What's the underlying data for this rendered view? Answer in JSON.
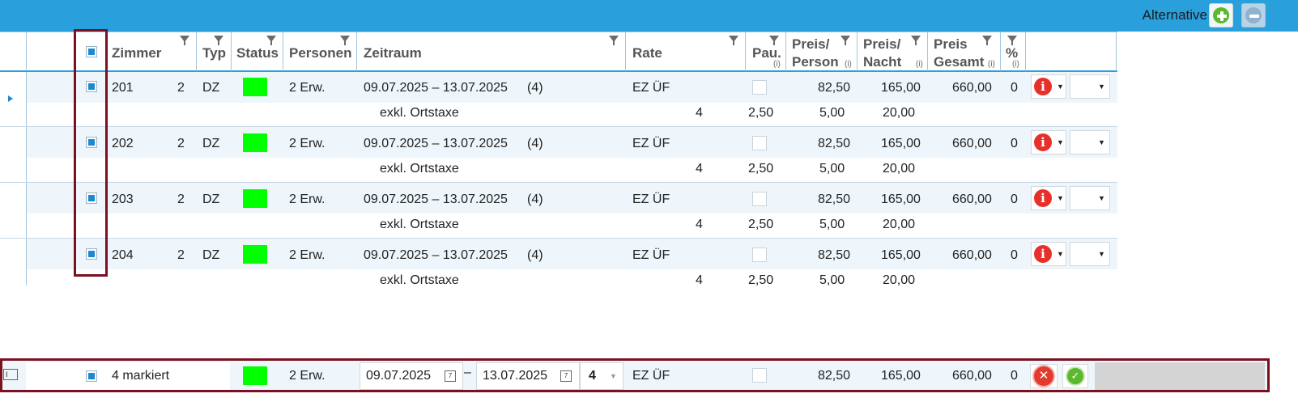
{
  "toolbar": {
    "alternative_label": "Alternative",
    "add_icon": "plus-circle-icon",
    "remove_icon": "minus-circle-icon",
    "accent_color": "#29a0dc"
  },
  "columns": {
    "zimmer": "Zimmer",
    "typ": "Typ",
    "status": "Status",
    "personen": "Personen",
    "zeitraum": "Zeitraum",
    "rate": "Rate",
    "pau": "Pau.",
    "preis_person_1": "Preis/",
    "preis_person_2": "Person",
    "preis_nacht_1": "Preis/",
    "preis_nacht_2": "Nacht",
    "preis_gesamt_1": "Preis",
    "preis_gesamt_2": "Gesamt",
    "prozent": "%",
    "info": "(i)"
  },
  "rows": [
    {
      "zimmer": "201",
      "beds": "2",
      "typ": "DZ",
      "personen": "2 Erw.",
      "zeitraum": "09.07.2025 – 13.07.2025",
      "nights": "(4)",
      "rate": "EZ ÜF",
      "preis_person": "82,50",
      "preis_nacht": "165,00",
      "preis_gesamt": "660,00",
      "prozent": "0",
      "sub_label": "exkl. Ortstaxe",
      "sub_qty": "4",
      "sub_pau": "2,50",
      "sub_person": "5,00",
      "sub_nacht": "20,00",
      "status_color": "#00ff00"
    },
    {
      "zimmer": "202",
      "beds": "2",
      "typ": "DZ",
      "personen": "2 Erw.",
      "zeitraum": "09.07.2025 – 13.07.2025",
      "nights": "(4)",
      "rate": "EZ ÜF",
      "preis_person": "82,50",
      "preis_nacht": "165,00",
      "preis_gesamt": "660,00",
      "prozent": "0",
      "sub_label": "exkl. Ortstaxe",
      "sub_qty": "4",
      "sub_pau": "2,50",
      "sub_person": "5,00",
      "sub_nacht": "20,00",
      "status_color": "#00ff00"
    },
    {
      "zimmer": "203",
      "beds": "2",
      "typ": "DZ",
      "personen": "2 Erw.",
      "zeitraum": "09.07.2025 – 13.07.2025",
      "nights": "(4)",
      "rate": "EZ ÜF",
      "preis_person": "82,50",
      "preis_nacht": "165,00",
      "preis_gesamt": "660,00",
      "prozent": "0",
      "sub_label": "exkl. Ortstaxe",
      "sub_qty": "4",
      "sub_pau": "2,50",
      "sub_person": "5,00",
      "sub_nacht": "20,00",
      "status_color": "#00ff00"
    },
    {
      "zimmer": "204",
      "beds": "2",
      "typ": "DZ",
      "personen": "2 Erw.",
      "zeitraum": "09.07.2025 – 13.07.2025",
      "nights": "(4)",
      "rate": "EZ ÜF",
      "preis_person": "82,50",
      "preis_nacht": "165,00",
      "preis_gesamt": "660,00",
      "prozent": "0",
      "sub_label": "exkl. Ortstaxe",
      "sub_qty": "4",
      "sub_pau": "2,50",
      "sub_person": "5,00",
      "sub_nacht": "20,00",
      "status_color": "#00ff00"
    }
  ],
  "edit_row": {
    "marked_label": "4 markiert",
    "personen": "2 Erw.",
    "date_from": "09.07.2025",
    "date_dash": "–",
    "date_to": "13.07.2025",
    "nights": "4",
    "rate": "EZ ÜF",
    "preis_person": "82,50",
    "preis_nacht": "165,00",
    "preis_gesamt": "660,00",
    "prozent": "0",
    "calendar_day": "7",
    "cancel_icon": "x-circle-icon",
    "confirm_icon": "check-circle-icon"
  },
  "highlight_color": "#7a1020"
}
